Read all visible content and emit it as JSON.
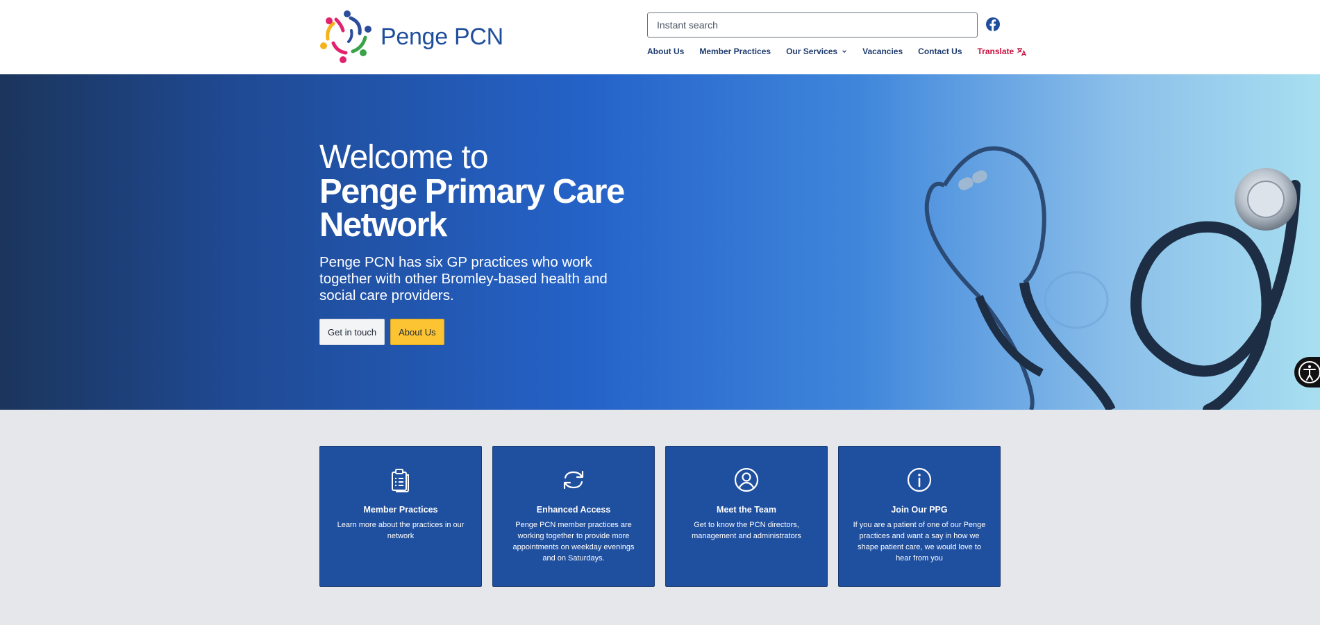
{
  "header": {
    "logo_text": "Penge PCN",
    "search_placeholder": "Instant search",
    "facebook_icon": "facebook-icon",
    "nav": {
      "about": "About Us",
      "practices": "Member Practices",
      "services": "Our Services",
      "vacancies": "Vacancies",
      "contact": "Contact Us",
      "translate": "Translate"
    }
  },
  "hero": {
    "welcome": "Welcome to",
    "title_line1": "Penge Primary Care",
    "title_line2": "Network",
    "subtitle": "Penge PCN has six GP practices who work together with other Bromley-based health and social care providers.",
    "btn_contact": "Get in touch",
    "btn_about": "About Us"
  },
  "cards": [
    {
      "icon": "clipboard-icon",
      "title": "Member Practices",
      "desc": "Learn more about the practices in our network"
    },
    {
      "icon": "refresh-icon",
      "title": "Enhanced Access",
      "desc": "Penge PCN member practices are working together to provide more appointments on weekday evenings and on Saturdays."
    },
    {
      "icon": "user-circle-icon",
      "title": "Meet the Team",
      "desc": "Get to know the PCN directors, management and administrators"
    },
    {
      "icon": "info-icon",
      "title": "Join Our PPG",
      "desc": "If you are a patient of one of our Penge practices and want a say in how we shape patient care, we would love to hear from you"
    }
  ],
  "colors": {
    "brand_blue": "#1f4e9c",
    "card_blue": "#1f4f9f",
    "accent_yellow": "#fcc332",
    "translate_red": "#c8103e"
  }
}
